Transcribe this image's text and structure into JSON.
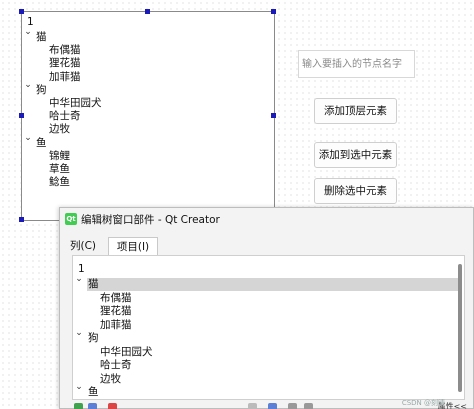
{
  "designer_tree": {
    "header": "1",
    "items": [
      {
        "label": "猫",
        "level": 0
      },
      {
        "label": "布偶猫",
        "level": 1
      },
      {
        "label": "狸花猫",
        "level": 1
      },
      {
        "label": "加菲猫",
        "level": 1
      },
      {
        "label": "狗",
        "level": 0
      },
      {
        "label": "中华田园犬",
        "level": 1
      },
      {
        "label": "哈士奇",
        "level": 1
      },
      {
        "label": "边牧",
        "level": 1
      },
      {
        "label": "鱼",
        "level": 0
      },
      {
        "label": "锦鲤",
        "level": 1
      },
      {
        "label": "草鱼",
        "level": 1
      },
      {
        "label": "鲶鱼",
        "level": 1
      }
    ]
  },
  "controls": {
    "node_input_placeholder": "输入要插入的节点名字",
    "add_top_button": "添加顶层元素",
    "add_to_selected_button": "添加到选中元素",
    "delete_selected_button": "删除选中元素"
  },
  "dialog": {
    "title": "编辑树窗口部件 - Qt Creator",
    "tabs": [
      {
        "label": "列(C)",
        "active": false
      },
      {
        "label": "项目(I)",
        "active": true
      }
    ],
    "tree_header": "1",
    "items": [
      {
        "label": "猫",
        "level": 0
      },
      {
        "label": "布偶猫",
        "level": 1
      },
      {
        "label": "狸花猫",
        "level": 1
      },
      {
        "label": "加菲猫",
        "level": 1
      },
      {
        "label": "狗",
        "level": 0
      },
      {
        "label": "中华田园犬",
        "level": 1
      },
      {
        "label": "哈士奇",
        "level": 1
      },
      {
        "label": "边牧",
        "level": 1
      },
      {
        "label": "鱼",
        "level": 0
      }
    ],
    "properties_button": "属性<<",
    "watermark": "CSDN @刻晴"
  },
  "colors": {
    "selection_handle": "#1a1ab8",
    "qt_green": "#41cd52",
    "selected_row": "#d5d5d5"
  }
}
